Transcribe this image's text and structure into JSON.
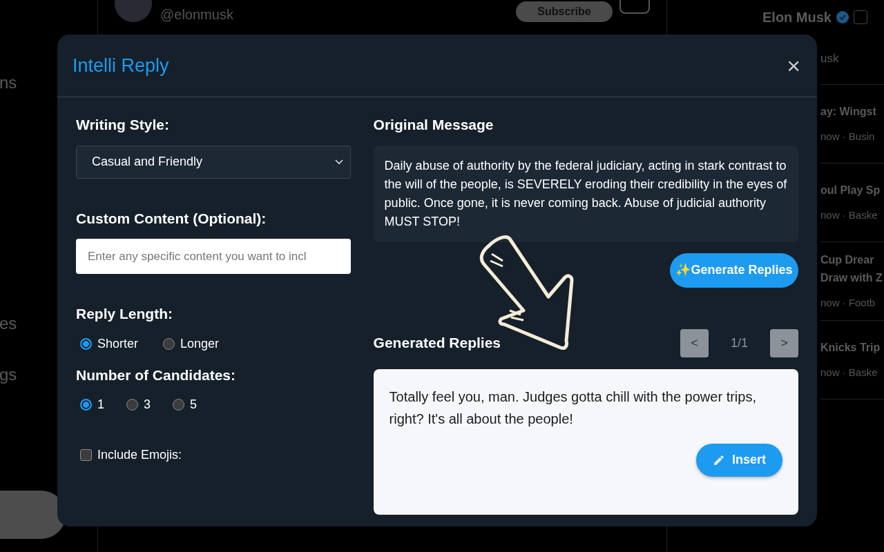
{
  "background": {
    "profile_handle": "@elonmusk",
    "subscribe_button": "Subscribe",
    "nav_items": [
      "ns",
      "es",
      "gs"
    ],
    "side_account": {
      "name": "Elon Musk",
      "verified": true,
      "handle": "usk"
    },
    "trends": [
      {
        "lines": [
          "ay: Wingst"
        ],
        "meta": "now · Busin"
      },
      {
        "lines": [
          "oul Play Sp"
        ],
        "meta": "now · Baske"
      },
      {
        "lines": [
          "Cup Drear",
          "Draw with Z"
        ],
        "meta": "now · Footb"
      },
      {
        "lines": [
          "Knicks Trip"
        ],
        "meta": "now · Baske"
      }
    ]
  },
  "dialog": {
    "title": "Intelli Reply",
    "close": "×",
    "writing_style": {
      "label": "Writing Style:",
      "value": "Casual and Friendly"
    },
    "custom_content": {
      "label": "Custom Content (Optional):",
      "placeholder": "Enter any specific content you want to incl"
    },
    "reply_length": {
      "label": "Reply Length:",
      "options": [
        {
          "label": "Shorter",
          "selected": true
        },
        {
          "label": "Longer",
          "selected": false
        }
      ]
    },
    "candidates": {
      "label": "Number of Candidates:",
      "options": [
        {
          "label": "1",
          "selected": true
        },
        {
          "label": "3",
          "selected": false
        },
        {
          "label": "5",
          "selected": false
        }
      ]
    },
    "include_emojis": {
      "label": "Include Emojis:",
      "checked": false
    },
    "original_message": {
      "label": "Original Message",
      "text": "Daily abuse of authority by the federal judiciary, acting in stark contrast to the will of the people, is SEVERELY eroding their credibility in the eyes of public. Once gone, it is never coming back. Abuse of judicial authority MUST STOP!"
    },
    "generate_button": "✨Generate Replies",
    "generated": {
      "label": "Generated Replies",
      "prev": "<",
      "page": "1/1",
      "next": ">",
      "reply": "Totally feel you, man. Judges gotta chill with the power trips, right? It's all about the people!",
      "insert_button": "Insert"
    }
  }
}
